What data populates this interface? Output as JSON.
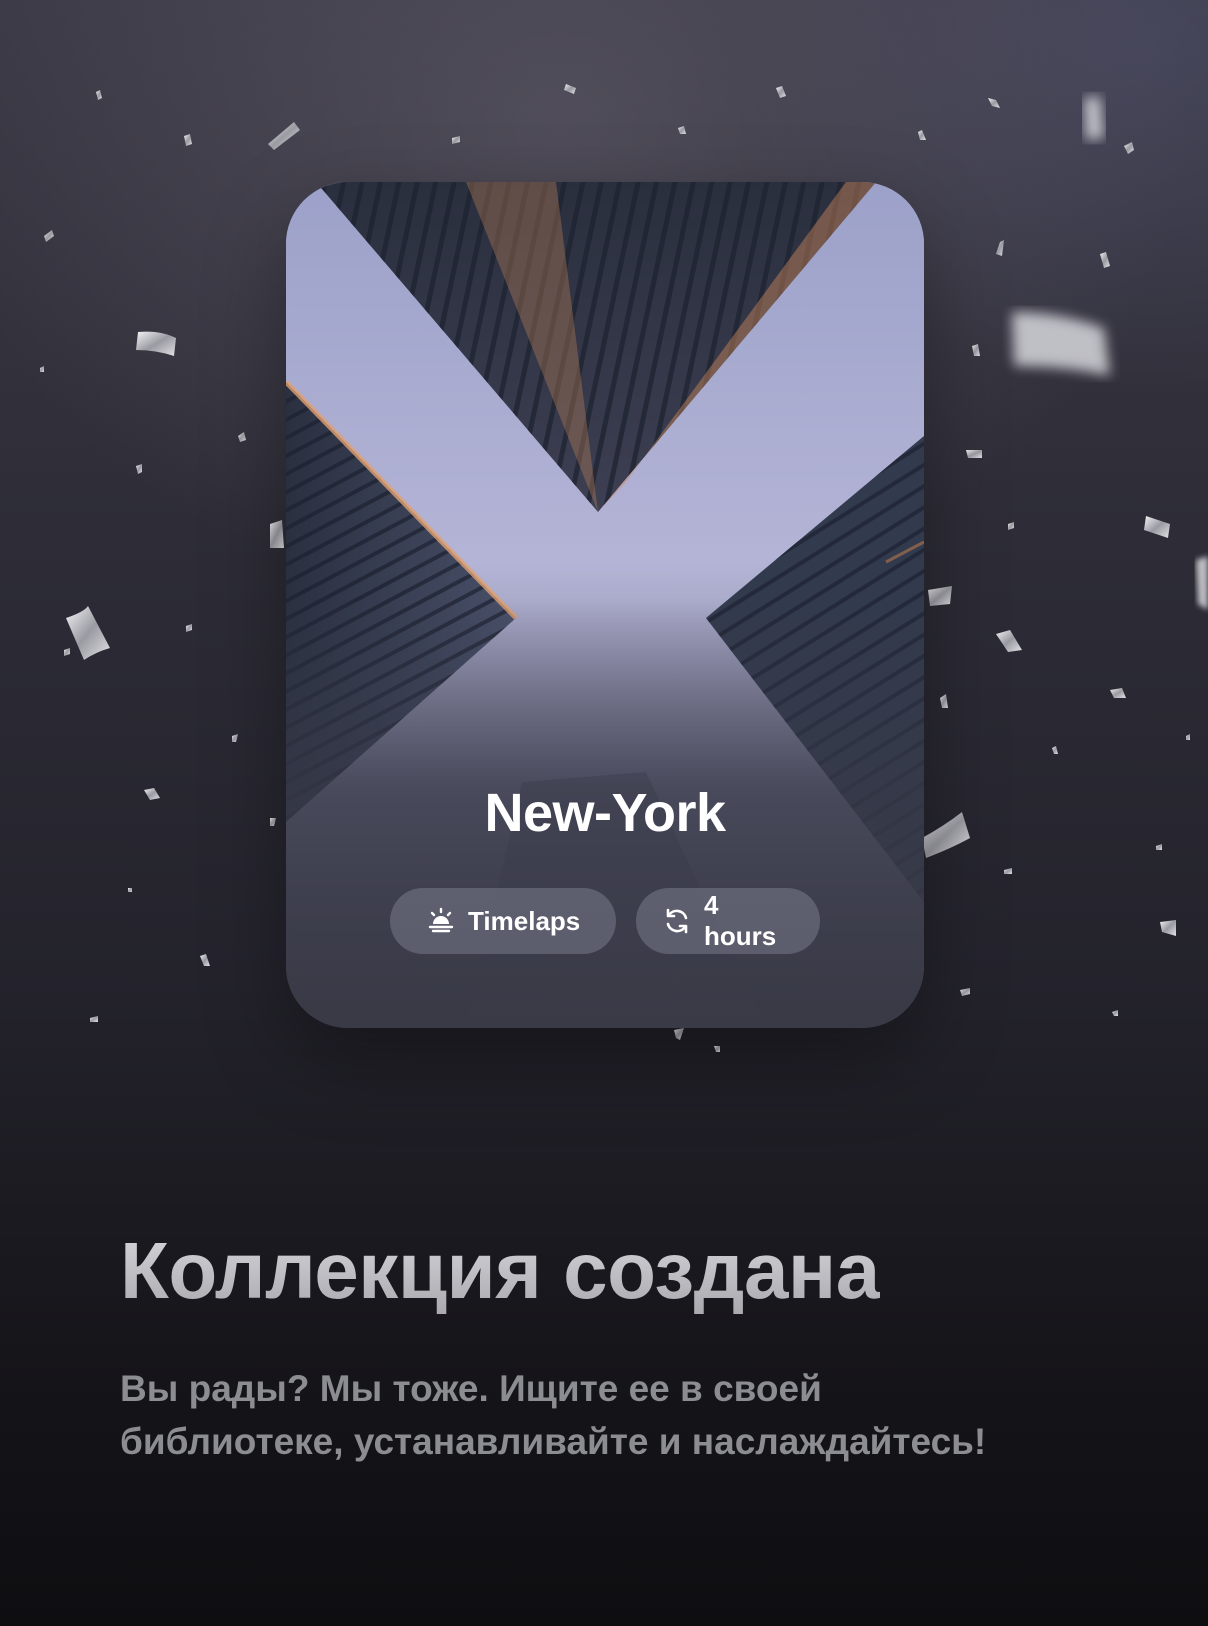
{
  "card": {
    "title": "New-York",
    "chips": [
      {
        "label": "Timelaps",
        "icon": "sunrise-icon"
      },
      {
        "label": "4 hours",
        "icon": "refresh-icon"
      }
    ]
  },
  "heading": "Коллекция создана",
  "subtext_line1": "Вы рады? Мы тоже. Ищите ее в своей",
  "subtext_line2": "библиотеке, устанавливайте и наслаждайтесь!",
  "colors": {
    "background_top": "#3b3945",
    "background_bottom": "#0e0e11",
    "chip_background": "#7a7c8a",
    "heading": "#d7d7dc",
    "subtext": "#8c8c93"
  }
}
